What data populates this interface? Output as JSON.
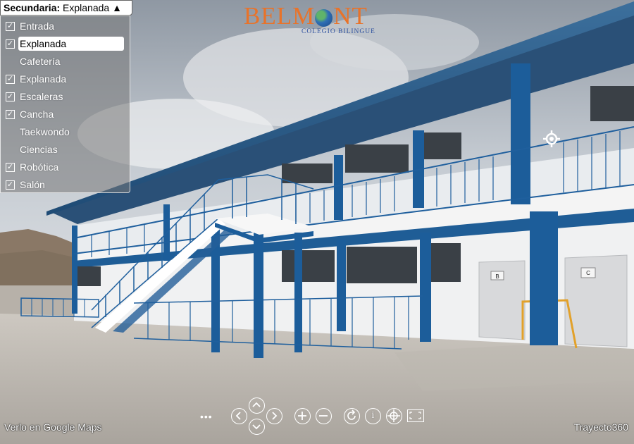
{
  "logo": {
    "name_left": "BELM",
    "name_right": "NT",
    "subtitle": "COLEGIO BILINGUE"
  },
  "menu": {
    "prefix": "Secundaria:",
    "selected": "Explanada",
    "toggle_icon": "▲",
    "items": [
      {
        "label": "Entrada",
        "checked": true
      },
      {
        "label": "Explanada",
        "checked": true
      },
      {
        "label": "Cafetería",
        "checked": false
      },
      {
        "label": "Explanada",
        "checked": true
      },
      {
        "label": "Escaleras",
        "checked": true
      },
      {
        "label": "Cancha",
        "checked": true
      },
      {
        "label": "Taekwondo",
        "checked": false
      },
      {
        "label": "Ciencias",
        "checked": false
      },
      {
        "label": "Robótica",
        "checked": true
      },
      {
        "label": "Salón",
        "checked": true
      }
    ]
  },
  "controls": {
    "more": "•••",
    "info": "i"
  },
  "footer": {
    "google_maps_link": "Verlo en Google Maps",
    "brand": "Trayecto360"
  },
  "signs": {
    "door_b": "B",
    "door_c": "C"
  }
}
